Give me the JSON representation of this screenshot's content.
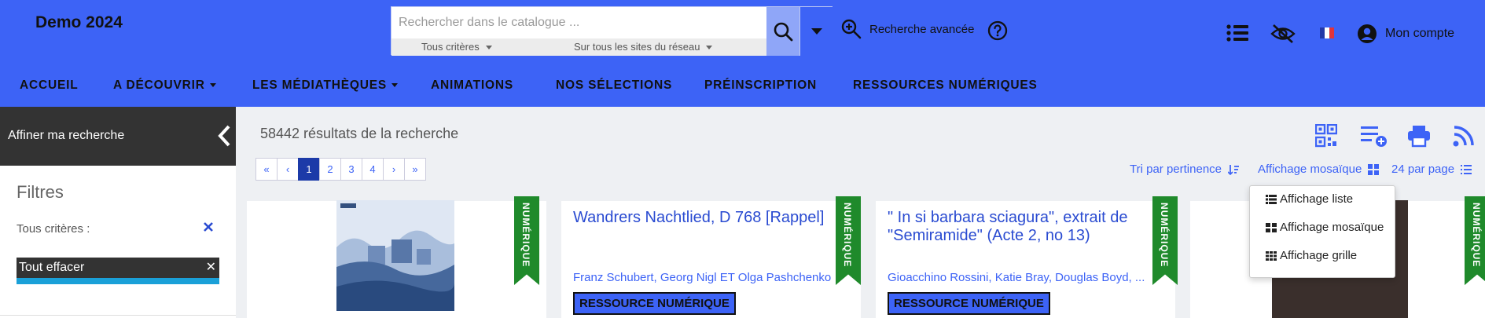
{
  "header": {
    "brand": "Demo 2024",
    "search": {
      "placeholder": "Rechercher dans le catalogue ...",
      "criteria": "Tous critères",
      "scope": "Sur tous les sites du réseau"
    },
    "advanced_search": "Recherche avancée",
    "account": "Mon compte",
    "accent": "#3d63f6"
  },
  "nav": {
    "items": [
      {
        "label": "ACCUEIL"
      },
      {
        "label": "A DÉCOUVRIR"
      },
      {
        "label": "LES MÉDIATHÈQUES"
      },
      {
        "label": "ANIMATIONS"
      },
      {
        "label": "NOS SÉLECTIONS"
      },
      {
        "label": "PRÉINSCRIPTION"
      },
      {
        "label": "RESSOURCES NUMÉRIQUES"
      }
    ]
  },
  "sidebar": {
    "title": "Affiner ma recherche",
    "filters_title": "Filtres",
    "criteria_label": "Tous critères :",
    "clear_all": "Tout effacer"
  },
  "results": {
    "count_text": "58442 résultats de la recherche",
    "pagination": [
      "«",
      "‹",
      "1",
      "2",
      "3",
      "4",
      "›",
      "»"
    ],
    "active_page": "1",
    "sort": "Tri par pertinence",
    "display": "Affichage mosaïque",
    "per_page": "24 par page"
  },
  "display_menu": {
    "items": [
      "Affichage liste",
      "Affichage mosaïque",
      "Affichage grille"
    ]
  },
  "cards": [
    {
      "badge": "NUMÉRIQUE"
    },
    {
      "badge": "NUMÉRIQUE",
      "title": "Wandrers Nachtlied, D 768 [Rappel]",
      "authors": "Franz Schubert, Georg Nigl ET Olga Pashchenko",
      "type": "RESSOURCE NUMÉRIQUE"
    },
    {
      "badge": "NUMÉRIQUE",
      "title": "\" In si barbara sciagura\", extrait de \"Semiramide\" (Acte 2, no 13)",
      "authors": "Gioacchino Rossini, Katie Bray, Douglas Boyd, ...",
      "type": "RESSOURCE NUMÉRIQUE"
    },
    {
      "badge": "NUMÉRIQUE"
    }
  ]
}
